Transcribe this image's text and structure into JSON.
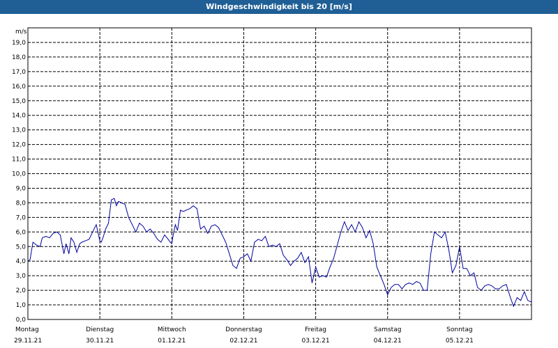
{
  "window": {
    "title": "Windgeschwindigkeit bis 20 [m/s]"
  },
  "colors": {
    "title_bar": "#1f5f96",
    "series_line": "#0000a0",
    "grid": "#000000",
    "background": "#ffffff"
  },
  "chart_data": {
    "type": "line",
    "title": "Windgeschwindigkeit bis 20 [m/s]",
    "ylabel": "m/s",
    "xlabel": "",
    "ylim": [
      0,
      20
    ],
    "xlim": [
      0,
      7
    ],
    "grid": true,
    "x_unit": "days since Monday 29.11.21 00:00",
    "y_ticks": [
      "0,0",
      "1,0",
      "2,0",
      "3,0",
      "4,0",
      "5,0",
      "6,0",
      "7,0",
      "8,0",
      "9,0",
      "10,0",
      "11,0",
      "12,0",
      "13,0",
      "14,0",
      "15,0",
      "16,0",
      "17,0",
      "18,0",
      "19,0"
    ],
    "x_ticks": [
      {
        "day": "Montag",
        "date": "29.11.21"
      },
      {
        "day": "Dienstag",
        "date": "30.11.21"
      },
      {
        "day": "Mittwoch",
        "date": "01.12.21"
      },
      {
        "day": "Donnerstag",
        "date": "02.12.21"
      },
      {
        "day": "Freitag",
        "date": "03.12.21"
      },
      {
        "day": "Samstag",
        "date": "04.12.21"
      },
      {
        "day": "Sonntag",
        "date": "05.12.21"
      }
    ],
    "series": [
      {
        "x": [
          0.0,
          0.03,
          0.07,
          0.12,
          0.17,
          0.2,
          0.25,
          0.3,
          0.35,
          0.4,
          0.45,
          0.5,
          0.53,
          0.57,
          0.6,
          0.64,
          0.68,
          0.72,
          0.75,
          0.8,
          0.85,
          0.9,
          0.95,
          1.0,
          1.02,
          1.05,
          1.08,
          1.12,
          1.16,
          1.2,
          1.23,
          1.26,
          1.3,
          1.35,
          1.4,
          1.45,
          1.5,
          1.55,
          1.6,
          1.65,
          1.7,
          1.75,
          1.8,
          1.85,
          1.9,
          1.95,
          1.98,
          2.0,
          2.02,
          2.05,
          2.08,
          2.12,
          2.16,
          2.2,
          2.25,
          2.3,
          2.35,
          2.4,
          2.45,
          2.5,
          2.55,
          2.6,
          2.65,
          2.7,
          2.75,
          2.8,
          2.85,
          2.9,
          2.95,
          3.0,
          3.05,
          3.1,
          3.15,
          3.2,
          3.25,
          3.3,
          3.35,
          3.4,
          3.45,
          3.5,
          3.55,
          3.6,
          3.65,
          3.7,
          3.75,
          3.8,
          3.85,
          3.9,
          3.95,
          4.0,
          4.05,
          4.1,
          4.15,
          4.2,
          4.25,
          4.3,
          4.35,
          4.4,
          4.45,
          4.5,
          4.55,
          4.6,
          4.65,
          4.7,
          4.75,
          4.8,
          4.85,
          4.9,
          4.95,
          5.0,
          5.05,
          5.1,
          5.15,
          5.2,
          5.25,
          5.3,
          5.35,
          5.4,
          5.45,
          5.5,
          5.55,
          5.6,
          5.65,
          5.7,
          5.75,
          5.8,
          5.85,
          5.9,
          5.95,
          6.0,
          6.05,
          6.1,
          6.15,
          6.2,
          6.25,
          6.3,
          6.35,
          6.4,
          6.45,
          6.5,
          6.55,
          6.6,
          6.65,
          6.7,
          6.75,
          6.8,
          6.85,
          6.9,
          6.95,
          7.0
        ],
        "y": [
          4.0,
          4.1,
          5.3,
          5.1,
          5.0,
          5.6,
          5.7,
          5.6,
          5.9,
          6.0,
          5.8,
          4.5,
          5.2,
          4.5,
          5.6,
          5.3,
          4.6,
          5.2,
          5.3,
          5.4,
          5.5,
          6.0,
          6.5,
          5.4,
          5.3,
          5.7,
          6.2,
          6.6,
          8.2,
          8.3,
          7.8,
          8.1,
          8.0,
          7.9,
          7.0,
          6.5,
          6.0,
          6.6,
          6.4,
          6.0,
          6.2,
          5.9,
          5.5,
          5.3,
          5.8,
          5.5,
          5.3,
          5.2,
          5.8,
          6.5,
          6.1,
          7.5,
          7.4,
          7.5,
          7.6,
          7.8,
          7.6,
          6.2,
          6.4,
          5.9,
          6.4,
          6.5,
          6.3,
          5.8,
          5.3,
          4.5,
          3.7,
          3.5,
          4.2,
          4.3,
          4.5,
          4.0,
          5.3,
          5.5,
          5.4,
          5.7,
          5.0,
          5.1,
          5.0,
          5.2,
          4.4,
          4.1,
          3.7,
          4.0,
          4.2,
          4.6,
          3.9,
          4.3,
          2.5,
          3.6,
          2.9,
          3.0,
          2.9,
          3.6,
          4.2,
          5.1,
          6.0,
          6.7,
          6.1,
          6.5,
          6.0,
          6.7,
          6.3,
          5.6,
          6.1,
          5.2,
          3.6,
          3.0,
          2.4,
          1.7,
          2.2,
          2.4,
          2.4,
          2.1,
          2.4,
          2.5,
          2.4,
          2.6,
          2.5,
          2.0,
          2.0,
          4.5,
          6.0,
          5.8,
          5.6,
          6.0,
          4.8,
          3.2,
          3.7,
          5.0,
          3.5,
          3.5,
          3.0,
          3.2,
          2.2,
          2.0,
          2.3,
          2.4,
          2.3,
          2.1,
          2.1,
          2.3,
          2.4,
          1.6,
          0.9,
          1.5,
          1.3,
          1.9,
          1.3,
          1.2
        ]
      }
    ]
  }
}
